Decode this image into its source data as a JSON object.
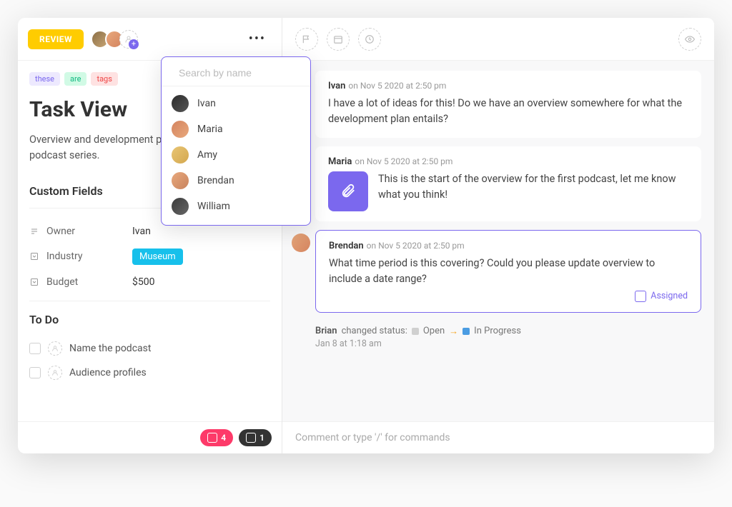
{
  "header": {
    "review_label": "REVIEW",
    "search_placeholder": "Search by name"
  },
  "people": [
    {
      "name": "Ivan"
    },
    {
      "name": "Maria"
    },
    {
      "name": "Amy"
    },
    {
      "name": "Brendan"
    },
    {
      "name": "William"
    }
  ],
  "tags": [
    "these",
    "are",
    "tags"
  ],
  "task": {
    "title": "Task View",
    "description": "Overview and development plan for our original podcast series."
  },
  "custom_fields": {
    "heading": "Custom Fields",
    "rows": [
      {
        "label": "Owner",
        "value": "Ivan"
      },
      {
        "label": "Industry",
        "value": "Museum"
      },
      {
        "label": "Budget",
        "value": "$500"
      }
    ]
  },
  "todo": {
    "heading": "To Do",
    "items": [
      {
        "label": "Name the podcast"
      },
      {
        "label": "Audience profiles"
      }
    ]
  },
  "footer_pills": [
    {
      "count": "4"
    },
    {
      "count": "1"
    }
  ],
  "comments": [
    {
      "author": "Ivan",
      "ts": "on Nov 5 2020 at 2:50 pm",
      "text": "I have a lot of ideas for this! Do we have an overview somewhere for what the development plan entails?"
    },
    {
      "author": "Maria",
      "ts": "on Nov 5 2020 at 2:50 pm",
      "text": "This is the start of the overview for the first podcast, let me know what you think!"
    },
    {
      "author": "Brendan",
      "ts": "on Nov 5 2020 at 2:50 pm",
      "text": "What time period is this covering? Could you please update overview to include a date range?",
      "assigned_label": "Assigned"
    }
  ],
  "status_change": {
    "actor": "Brian",
    "verb": "changed status:",
    "from": "Open",
    "to": "In Progress",
    "ts": "Jan 8 at 1:18 am"
  },
  "composer": {
    "placeholder": "Comment or type '/' for commands"
  }
}
